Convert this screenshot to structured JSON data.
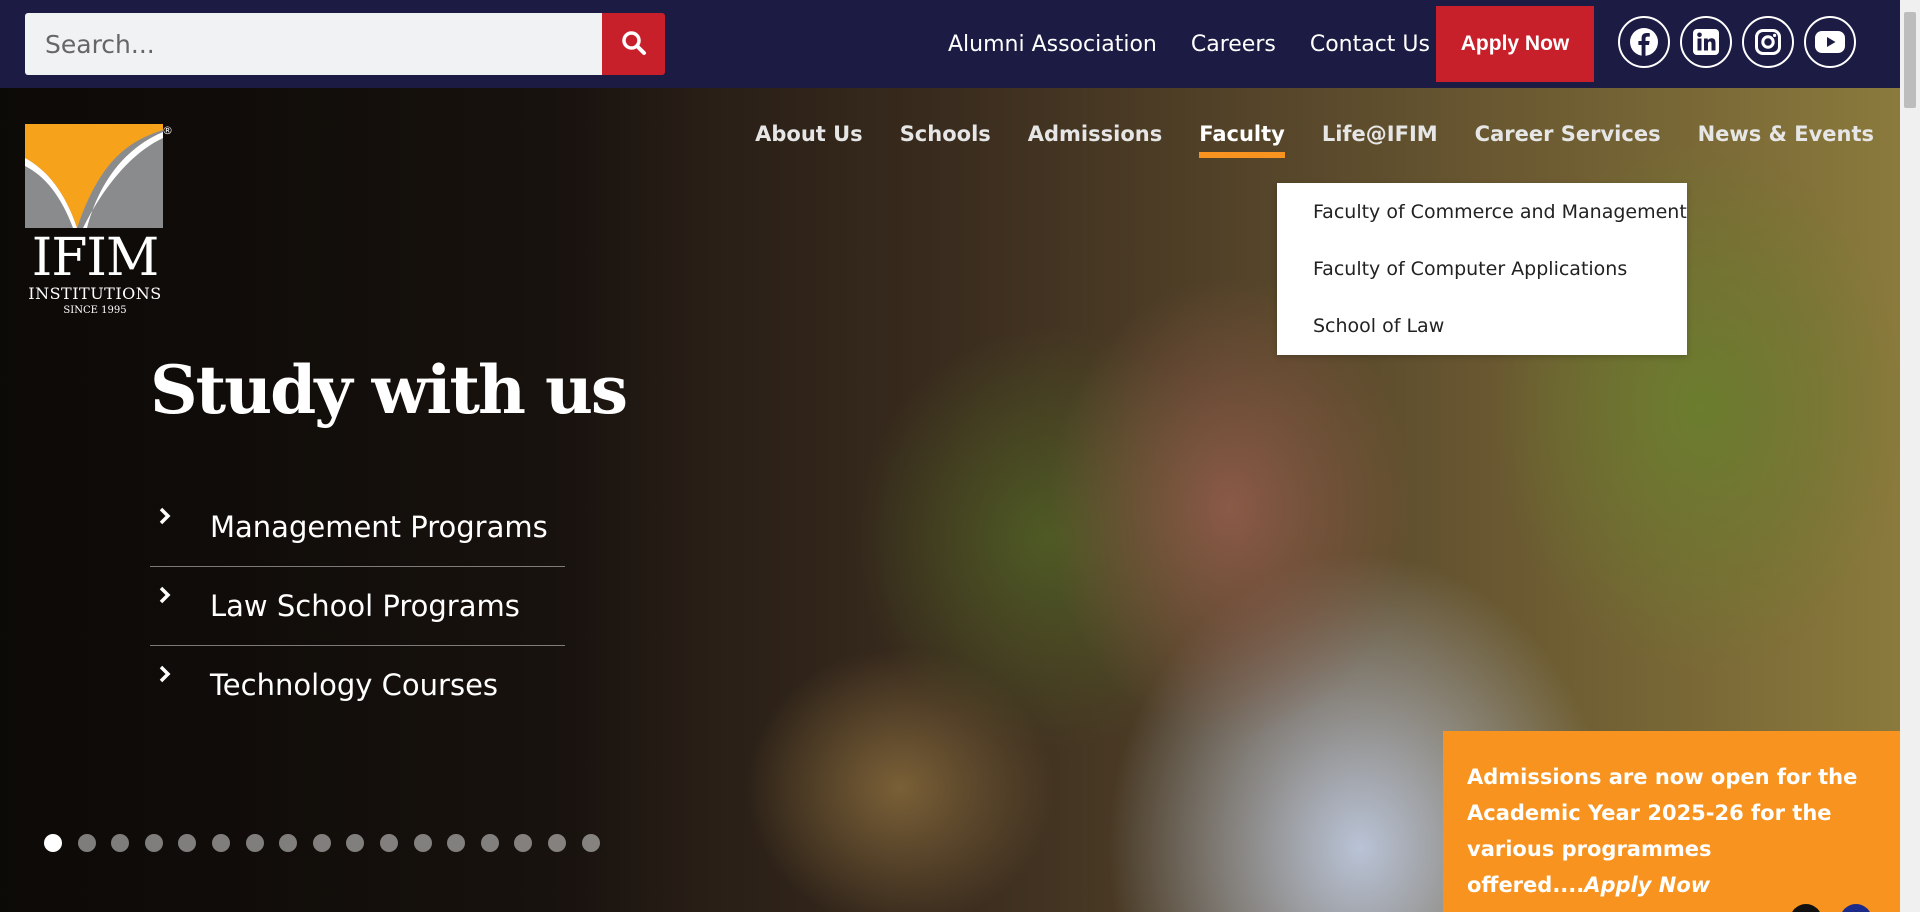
{
  "search": {
    "placeholder": "Search..."
  },
  "top_links": [
    "Alumni Association",
    "Careers",
    "Contact Us"
  ],
  "apply_button": "Apply Now",
  "socials": [
    "facebook-icon",
    "linkedin-icon",
    "instagram-icon",
    "youtube-icon"
  ],
  "logo": {
    "title": "IFIM",
    "subtitle": "INSTITUTIONS",
    "since": "SINCE 1995",
    "reg": "®"
  },
  "main_nav": {
    "items": [
      "About Us",
      "Schools",
      "Admissions",
      "Faculty",
      "Life@IFIM",
      "Career Services",
      "News & Events"
    ],
    "active": "Faculty"
  },
  "faculty_dropdown": [
    "Faculty of Commerce and Management",
    "Faculty of Computer Applications",
    "School of Law"
  ],
  "hero": {
    "title": "Study with us",
    "programs": [
      "Management Programs",
      "Law School Programs",
      "Technology Courses"
    ]
  },
  "carousel": {
    "slides": 17,
    "active_index": 0
  },
  "announcement": {
    "text": "Admissions are now open for the Academic Year 2025-26 for the various programmes offered....",
    "link": "Apply Now"
  },
  "colors": {
    "topbar": "#1c1b44",
    "accent_red": "#c8202b",
    "accent_orange": "#f7931e"
  }
}
